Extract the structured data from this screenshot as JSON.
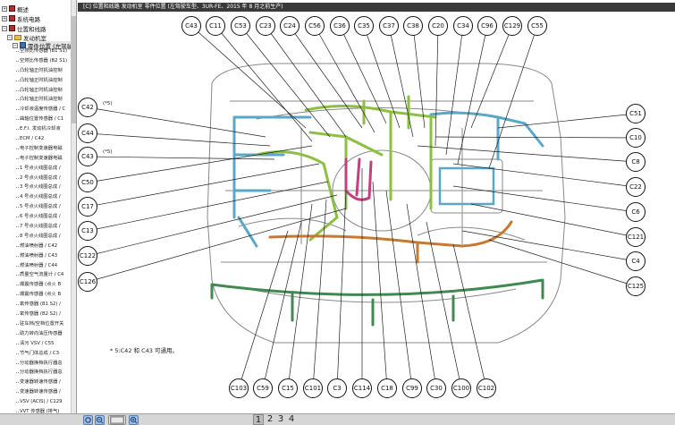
{
  "title_bar": "[C] 位置和线路   发动机室   零件位置 (左驾驶车型、3UR-FE、2015 年 8 月之前生产)",
  "sidebar": {
    "top_items": [
      "概述",
      "系统电路",
      "位置和线路",
      "发动机室",
      "零件位置 (左驾驶车"
    ],
    "items": [
      "空燃比传感器 (B1 S1)",
      "空燃比传感器 (B2 S1)",
      "凸轮轴正时机油控制",
      "凸轮轴正时机油控制",
      "凸轮轴正时机油控制",
      "凸轮轴正时机油控制",
      "冷却液温度传感器 / C",
      "曲轴位置传感器 / C1",
      "E.F.I. 发动机冷却液",
      "ECM / C42",
      "电子控制变速器电磁",
      "电子控制变速器电磁",
      "1 号点火线圈总成 /",
      "2 号点火线圈总成 /",
      "3 号点火线圈总成 /",
      "4 号点火线圈总成 /",
      "5 号点火线圈总成 /",
      "6 号点火线圈总成 /",
      "7 号点火线圈总成 /",
      "8 号点火线圈总成 /",
      "燃油喷射器 / C42",
      "燃油喷射器 / C43",
      "燃油喷射器 / C44",
      "质量空气流量计 / C4",
      "爆震传感器 (点火 B",
      "爆震传感器 (点火 B",
      "氧传感器 (B1 S2) /",
      "氧传感器 (B2 S2) /",
      "驻车档/空档位置开关",
      "助力转向油压传感器",
      "清污 VSV / C55",
      "节气门体总成 / C3",
      "分动器换档执行器总",
      "分动器换档执行器总",
      "变速器转速传感器 /",
      "变速器转速传感器 /",
      "VSV (ACIS) / C129",
      "VVT 传感器 (排气)"
    ]
  },
  "diagram": {
    "top_callouts": [
      "C43",
      "C11",
      "C53",
      "C23",
      "C24",
      "C56",
      "C36",
      "C35",
      "C37",
      "C38",
      "C20",
      "C34",
      "C96",
      "C129",
      "C55"
    ],
    "left_callouts": [
      "C42",
      "C44",
      "C43",
      "C50",
      "C17",
      "C13",
      "C122",
      "C126"
    ],
    "left_notes": [
      "(*5)",
      "(*5)"
    ],
    "right_callouts": [
      "C51",
      "C10",
      "C8",
      "C22",
      "C6",
      "C121",
      "C4",
      "C125"
    ],
    "bottom_callouts": [
      "C103",
      "C59",
      "C15",
      "C101",
      "C3",
      "C114",
      "C18",
      "C99",
      "C30",
      "C100",
      "C102"
    ],
    "note": "* 5:C42 和 C43 可通用。"
  },
  "toolbar": {
    "pages": [
      "1",
      "2",
      "3",
      "4"
    ],
    "active_page": "1",
    "buttons": [
      "refresh-icon",
      "zoom-out-icon",
      "fit-icon",
      "zoom-in-icon"
    ]
  },
  "colors": {
    "title_bg": "#3a3a3a",
    "wire_blue": "#5aa8c8",
    "wire_green": "#8cc040",
    "wire_dark_green": "#3f8a50",
    "wire_orange": "#c87830",
    "wire_magenta": "#c04080"
  }
}
